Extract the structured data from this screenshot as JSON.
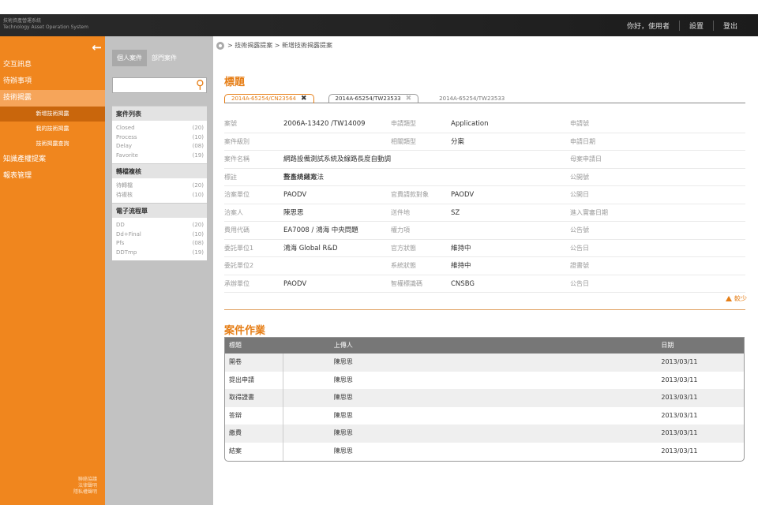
{
  "app": {
    "title_cn": "技術資產營運系統",
    "title_en": "Technology Asset Operation System"
  },
  "topnav": {
    "greeting": "你好，使用者",
    "settings": "設置",
    "logout": "登出"
  },
  "sidebar": {
    "items": [
      {
        "label": "交互訊息",
        "type": "main"
      },
      {
        "label": "待辦事項",
        "type": "main"
      },
      {
        "label": "技術揭露",
        "type": "main"
      },
      {
        "label": "新增技術揭露",
        "type": "sub"
      },
      {
        "label": "我的技術揭露",
        "type": "sub"
      },
      {
        "label": "技術揭露查詢",
        "type": "sub"
      },
      {
        "label": "知識產權提案",
        "type": "main"
      },
      {
        "label": "報表管理",
        "type": "main"
      }
    ],
    "footer": [
      "聯絡協議",
      "法律聲明",
      "隱私權聲明"
    ]
  },
  "casepanel": {
    "tab_personal": "個人案件",
    "tab_dept": "部門案件",
    "groups": [
      {
        "title": "案件列表",
        "rows": [
          {
            "name": "Closed",
            "count": "(20)"
          },
          {
            "name": "Process",
            "count": "(10)"
          },
          {
            "name": "Delay",
            "count": "(08)"
          },
          {
            "name": "Favorite",
            "count": "(19)"
          }
        ]
      },
      {
        "title": "轉檔複核",
        "rows": [
          {
            "name": "待轉檔",
            "count": "(20)"
          },
          {
            "name": "待複核",
            "count": "(10)"
          }
        ]
      },
      {
        "title": "電子流程單",
        "rows": [
          {
            "name": "DD",
            "count": "(20)"
          },
          {
            "name": "Dd+Final",
            "count": "(10)"
          },
          {
            "name": "Pfs",
            "count": "(08)"
          },
          {
            "name": "DDTmp",
            "count": "(19)"
          }
        ]
      }
    ]
  },
  "main": {
    "breadcrumb": "> 技術揭露提案 > 新增技術揭露提案",
    "section_title": "標題",
    "doctabs": [
      "2014A-65254/CN23564",
      "2014A-65254/TW23533",
      "2014A-65254/TW23533"
    ],
    "fields": [
      {
        "l1": "案號",
        "v1": "2006A-13420 /TW14009",
        "l2": "申請類型",
        "v2": "Application",
        "l3": "申請號"
      },
      {
        "l1": "案件級別",
        "v1": "",
        "l2": "相關類型",
        "v2": "分案",
        "l3": "申請日期"
      },
      {
        "l1": "案件名稱",
        "v1": "網路設備測試系統及線路長度自動調整系統與方法",
        "l2": "",
        "v2": "",
        "l3": "母案申請日"
      },
      {
        "l1": "標註",
        "v1": "審查終結案",
        "l2": "",
        "v2": "",
        "l3": "公開號"
      },
      {
        "l1": "洽案單位",
        "v1": "PAODV",
        "l2": "官費請款對象",
        "v2": "PAODV",
        "l3": "公開日"
      },
      {
        "l1": "洽案人",
        "v1": "陳思思",
        "l2": "送件地",
        "v2": "SZ",
        "l3": "進入實審日期"
      },
      {
        "l1": "費用代碼",
        "v1": "EA7008 / 鴻海 中央問題",
        "l2": "權力項",
        "v2": "",
        "l3": "公告號"
      },
      {
        "l1": "委託單位1",
        "v1": "鴻海 Global R&D",
        "l2": "官方狀態",
        "v2": "維持中",
        "l3": "公告日"
      },
      {
        "l1": "委託單位2",
        "v1": "",
        "l2": "系統狀態",
        "v2": "維持中",
        "l3": "證書號"
      },
      {
        "l1": "承辦單位",
        "v1": "PAODV",
        "l2": "智權標識碼",
        "v2": "CNSBG",
        "l3": "公告日"
      }
    ],
    "less_label": "較少",
    "work_title": "案件作業",
    "work_headers": {
      "title": "標題",
      "uploader": "上傳人",
      "date": "日期"
    },
    "work_rows": [
      {
        "title": "開卷",
        "uploader": "陳思思",
        "date": "2013/03/11"
      },
      {
        "title": "提出申請",
        "uploader": "陳思思",
        "date": "2013/03/11"
      },
      {
        "title": "取得證書",
        "uploader": "陳思思",
        "date": "2013/03/11"
      },
      {
        "title": "答辯",
        "uploader": "陳思思",
        "date": "2013/03/11"
      },
      {
        "title": "繳費",
        "uploader": "陳思思",
        "date": "2013/03/11"
      },
      {
        "title": "結案",
        "uploader": "陳思思",
        "date": "2013/03/11"
      }
    ]
  },
  "colors": {
    "accent": "#f0861e",
    "dark_header": "#232323",
    "panel_grey": "#c2c2c2"
  }
}
